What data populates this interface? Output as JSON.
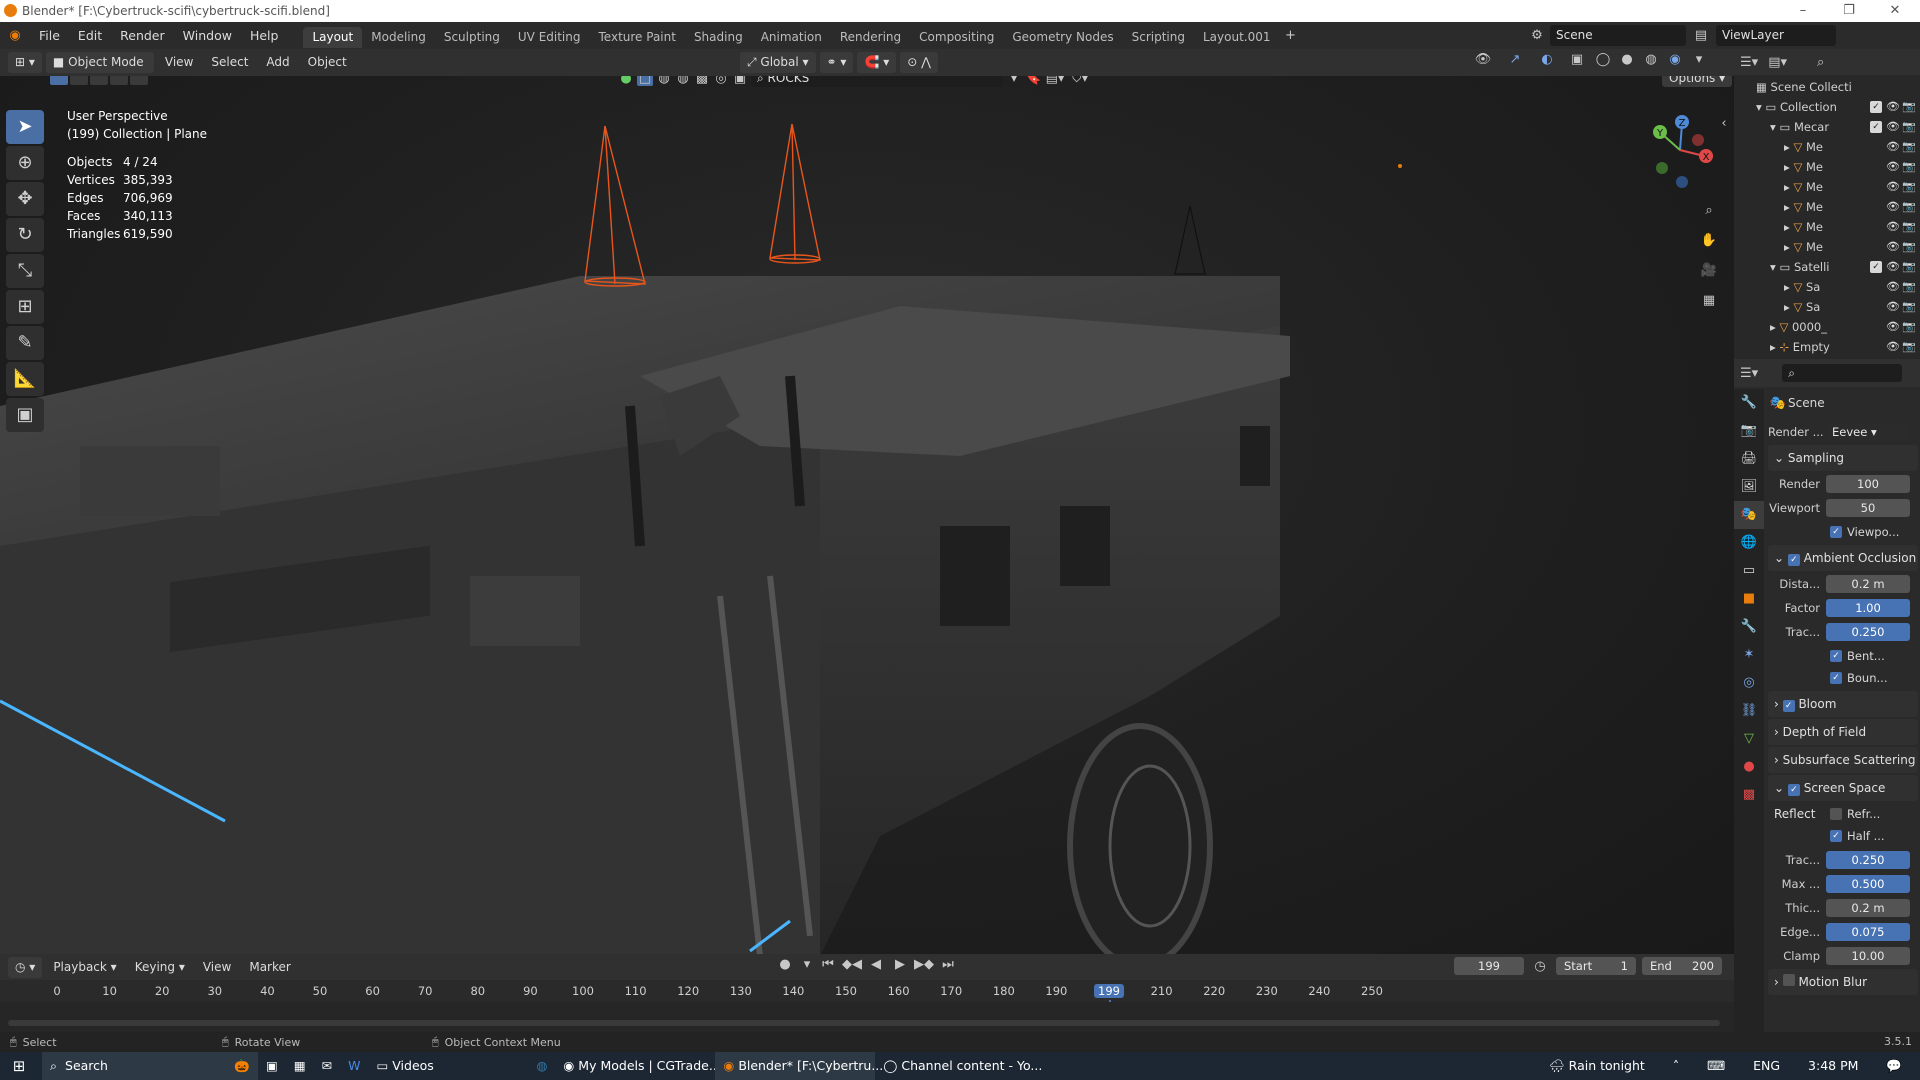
{
  "window": {
    "title": "Blender* [F:\\Cybertruck-scifi\\cybertruck-scifi.blend]"
  },
  "menu": [
    "File",
    "Edit",
    "Render",
    "Window",
    "Help"
  ],
  "workspaces": [
    "Layout",
    "Modeling",
    "Sculpting",
    "UV Editing",
    "Texture Paint",
    "Shading",
    "Animation",
    "Rendering",
    "Compositing",
    "Geometry Nodes",
    "Scripting",
    "Layout.001"
  ],
  "active_workspace": "Layout",
  "scene_name": "Scene",
  "view_layer": "ViewLayer",
  "viewport_header": {
    "mode": "Object Mode",
    "menus": [
      "View",
      "Select",
      "Add",
      "Object"
    ],
    "orientation": "Global",
    "collection_filter": "ROCKS",
    "options_label": "Options"
  },
  "viewport_info": {
    "perspective": "User Perspective",
    "context": "(199) Collection | Plane",
    "stats": [
      {
        "label": "Objects",
        "value": "4 / 24"
      },
      {
        "label": "Vertices",
        "value": "385,393"
      },
      {
        "label": "Edges",
        "value": "706,969"
      },
      {
        "label": "Faces",
        "value": "340,113"
      },
      {
        "label": "Triangles",
        "value": "619,590"
      }
    ]
  },
  "gizmo": {
    "x": "X",
    "y": "Y",
    "z": "Z"
  },
  "outliner": {
    "root": "Scene Collecti",
    "items": [
      {
        "name": "Collection",
        "indent": 1,
        "type": "collection"
      },
      {
        "name": "Mecar",
        "indent": 2,
        "type": "collection"
      },
      {
        "name": "Me",
        "indent": 3,
        "type": "mesh"
      },
      {
        "name": "Me",
        "indent": 3,
        "type": "mesh"
      },
      {
        "name": "Me",
        "indent": 3,
        "type": "mesh"
      },
      {
        "name": "Me",
        "indent": 3,
        "type": "mesh"
      },
      {
        "name": "Me",
        "indent": 3,
        "type": "mesh"
      },
      {
        "name": "Me",
        "indent": 3,
        "type": "mesh"
      },
      {
        "name": "Satelli",
        "indent": 2,
        "type": "collection"
      },
      {
        "name": "Sa",
        "indent": 3,
        "type": "mesh"
      },
      {
        "name": "Sa",
        "indent": 3,
        "type": "mesh"
      },
      {
        "name": "0000_",
        "indent": 2,
        "type": "mesh"
      },
      {
        "name": "Empty",
        "indent": 2,
        "type": "empty"
      }
    ]
  },
  "properties": {
    "scene_label": "Scene",
    "render_engine_label": "Render ...",
    "render_engine": "Eevee",
    "sampling": {
      "title": "Sampling",
      "render_label": "Render",
      "render": "100",
      "viewport_label": "Viewport",
      "viewport": "50",
      "viewport_denoise": "Viewpo..."
    },
    "ao": {
      "title": "Ambient Occlusion",
      "distance_label": "Dista...",
      "distance": "0.2 m",
      "factor_label": "Factor",
      "factor": "1.00",
      "trace_label": "Trac...",
      "trace": "0.250",
      "bent": "Bent...",
      "bounce": "Boun..."
    },
    "bloom": "Bloom",
    "dof": "Depth of Field",
    "sss": "Subsurface Scattering",
    "ssr": {
      "title": "Screen Space Reflect",
      "refraction": "Refr...",
      "half": "Half ...",
      "trace_label": "Trac...",
      "trace": "0.250",
      "max_label": "Max ...",
      "max": "0.500",
      "thick_label": "Thic...",
      "thick": "0.2 m",
      "edge_label": "Edge...",
      "edge": "0.075",
      "clamp_label": "Clamp",
      "clamp": "10.00"
    },
    "motion_blur": "Motion Blur"
  },
  "timeline": {
    "menus": [
      "Playback",
      "Keying",
      "View",
      "Marker"
    ],
    "current_frame": "199",
    "start_label": "Start",
    "start": "1",
    "end_label": "End",
    "end": "200",
    "ticks": [
      "0",
      "10",
      "20",
      "30",
      "40",
      "50",
      "60",
      "70",
      "80",
      "90",
      "100",
      "110",
      "120",
      "130",
      "140",
      "150",
      "160",
      "170",
      "180",
      "190",
      "199",
      "210",
      "220",
      "230",
      "240",
      "250"
    ]
  },
  "statusbar": {
    "select": "Select",
    "rotate": "Rotate View",
    "context_menu": "Object Context Menu",
    "version": "3.5.1"
  },
  "taskbar": {
    "search": "Search",
    "apps": [
      "Videos",
      "My Models | CGTrade...",
      "Blender* [F:\\Cybertru...",
      "Channel content - Yo..."
    ],
    "weather": "Rain tonight",
    "lang": "ENG",
    "time": "3:48 PM"
  },
  "colors": {
    "accent": "#4772b3",
    "blender_orange": "#e87d0d",
    "selected_outline": "#e8561c"
  }
}
